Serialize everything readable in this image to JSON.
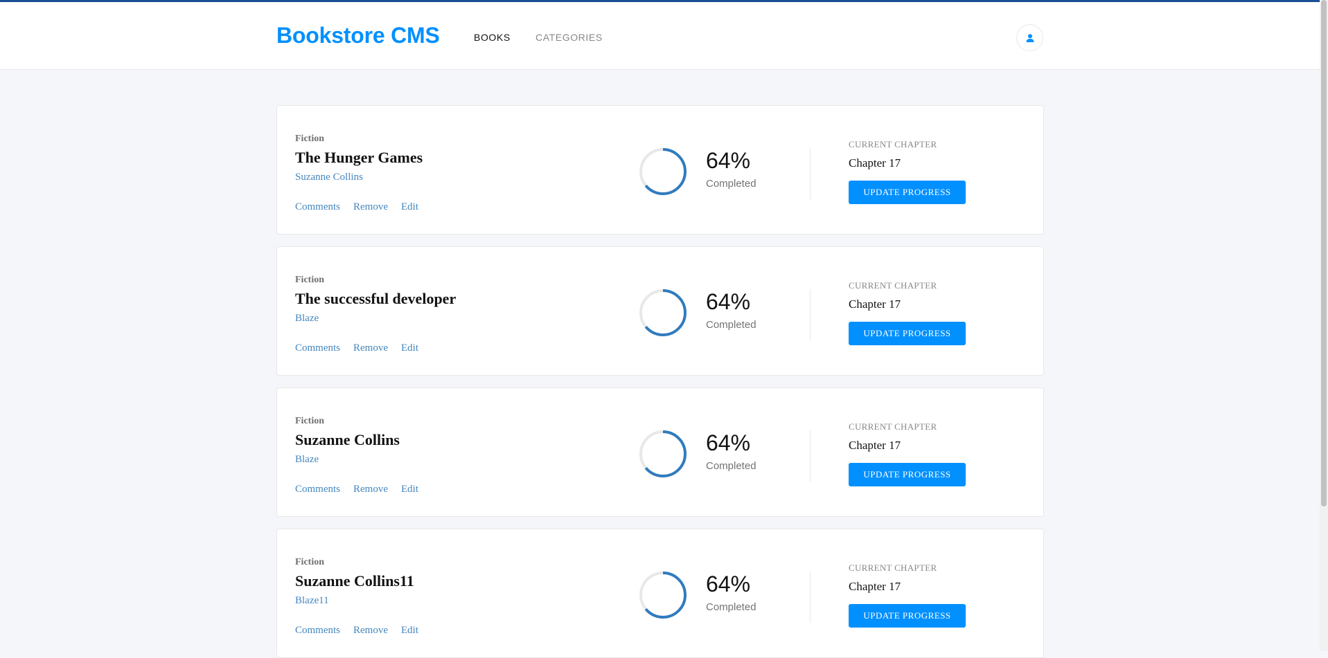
{
  "header": {
    "logo": "Bookstore CMS",
    "nav": [
      "BOOKS",
      "CATEGORIES"
    ],
    "avatar_icon": "user-icon"
  },
  "colors": {
    "brand": "#0290ff",
    "link": "#4386bf",
    "progress": "#307bbe",
    "track": "#e8e8e8",
    "topline": "#1a4f96"
  },
  "books": [
    {
      "genre": "Fiction",
      "title": "The Hunger Games",
      "author": "Suzanne Collins",
      "actions": [
        "Comments",
        "Remove",
        "Edit"
      ],
      "progress_percent": 64,
      "percent_text": "64%",
      "completed_label": "Completed",
      "current_chapter_label": "CURRENT CHAPTER",
      "current_chapter": "Chapter 17",
      "update_label": "UPDATE PROGRESS"
    },
    {
      "genre": "Fiction",
      "title": "The successful developer",
      "author": "Blaze",
      "actions": [
        "Comments",
        "Remove",
        "Edit"
      ],
      "progress_percent": 64,
      "percent_text": "64%",
      "completed_label": "Completed",
      "current_chapter_label": "CURRENT CHAPTER",
      "current_chapter": "Chapter 17",
      "update_label": "UPDATE PROGRESS"
    },
    {
      "genre": "Fiction",
      "title": "Suzanne Collins",
      "author": "Blaze",
      "actions": [
        "Comments",
        "Remove",
        "Edit"
      ],
      "progress_percent": 64,
      "percent_text": "64%",
      "completed_label": "Completed",
      "current_chapter_label": "CURRENT CHAPTER",
      "current_chapter": "Chapter 17",
      "update_label": "UPDATE PROGRESS"
    },
    {
      "genre": "Fiction",
      "title": "Suzanne Collins11",
      "author": "Blaze11",
      "actions": [
        "Comments",
        "Remove",
        "Edit"
      ],
      "progress_percent": 64,
      "percent_text": "64%",
      "completed_label": "Completed",
      "current_chapter_label": "CURRENT CHAPTER",
      "current_chapter": "Chapter 17",
      "update_label": "UPDATE PROGRESS"
    }
  ]
}
